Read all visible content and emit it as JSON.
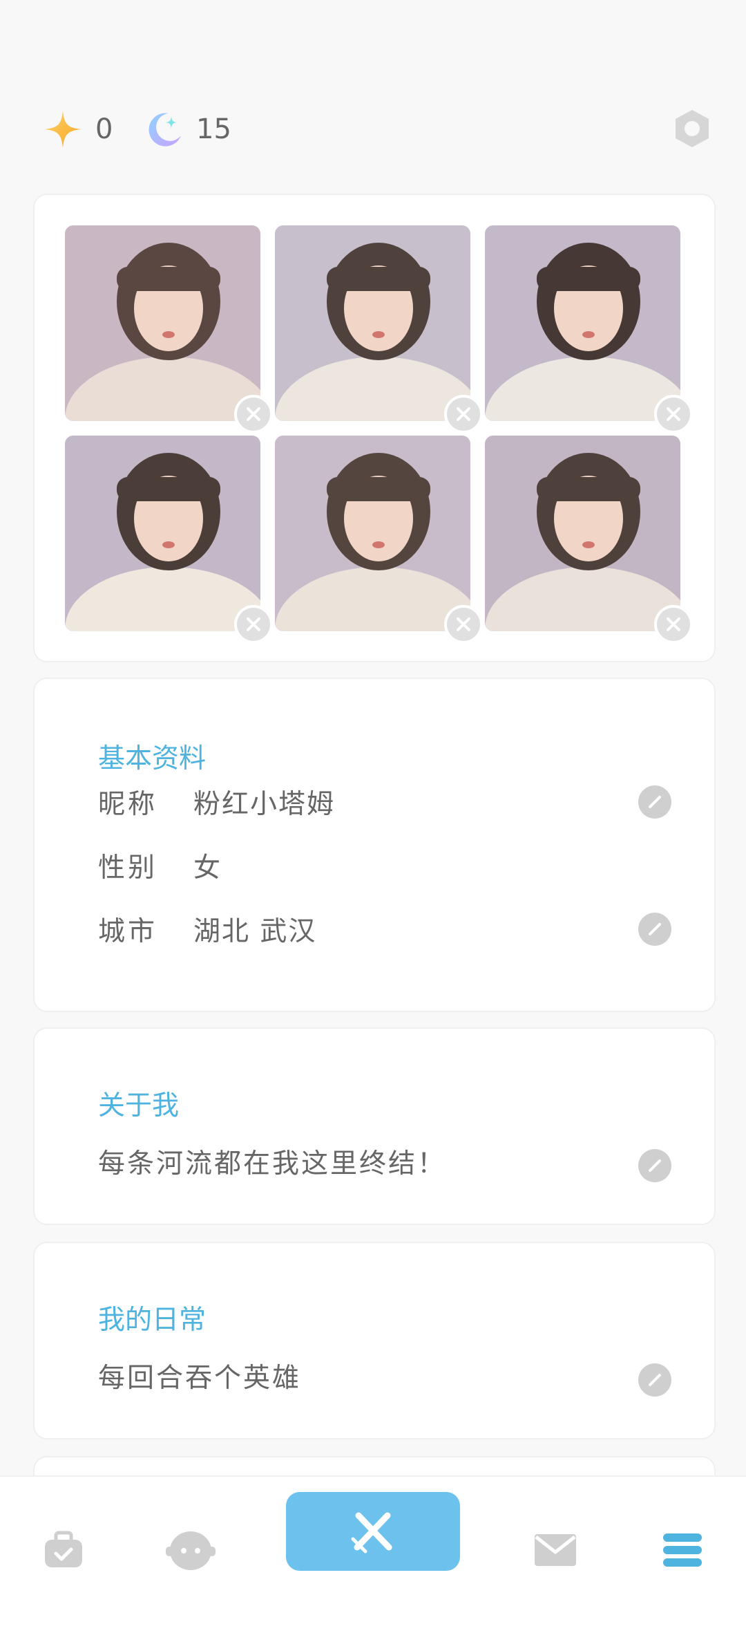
{
  "header": {
    "star_count": "0",
    "moon_count": "15"
  },
  "photos": [
    {
      "palette": [
        "#c9b7c3",
        "#e9ddd6",
        "#5a4741"
      ]
    },
    {
      "palette": [
        "#c8bfcc",
        "#ece6df",
        "#4f423d"
      ]
    },
    {
      "palette": [
        "#c4b9c9",
        "#ede7e1",
        "#463834"
      ]
    },
    {
      "palette": [
        "#c2b8c8",
        "#eee8df",
        "#4b3e39"
      ]
    },
    {
      "palette": [
        "#c8bccb",
        "#ebe2d9",
        "#55453f"
      ]
    },
    {
      "palette": [
        "#c3b6c4",
        "#eae2da",
        "#4e403b"
      ]
    }
  ],
  "basic_info": {
    "title": "基本资料",
    "rows": [
      {
        "label": "昵称",
        "value": "粉红小塔姆",
        "editable": true
      },
      {
        "label": "性别",
        "value": "女",
        "editable": false
      },
      {
        "label": "城市",
        "value": "湖北 武汉",
        "editable": true
      }
    ]
  },
  "about": {
    "title": "关于我",
    "text": "每条河流都在我这里终结！"
  },
  "daily": {
    "title": "我的日常",
    "text": "每回合吞个英雄"
  },
  "nav": {
    "items": [
      "bag-icon",
      "avatar-icon",
      "crossed-swords-icon",
      "mail-icon",
      "menu-icon"
    ],
    "accent": "#6cc2ec"
  },
  "colors": {
    "accent": "#4fb3e0",
    "icon_grey": "#cfcfcf"
  }
}
